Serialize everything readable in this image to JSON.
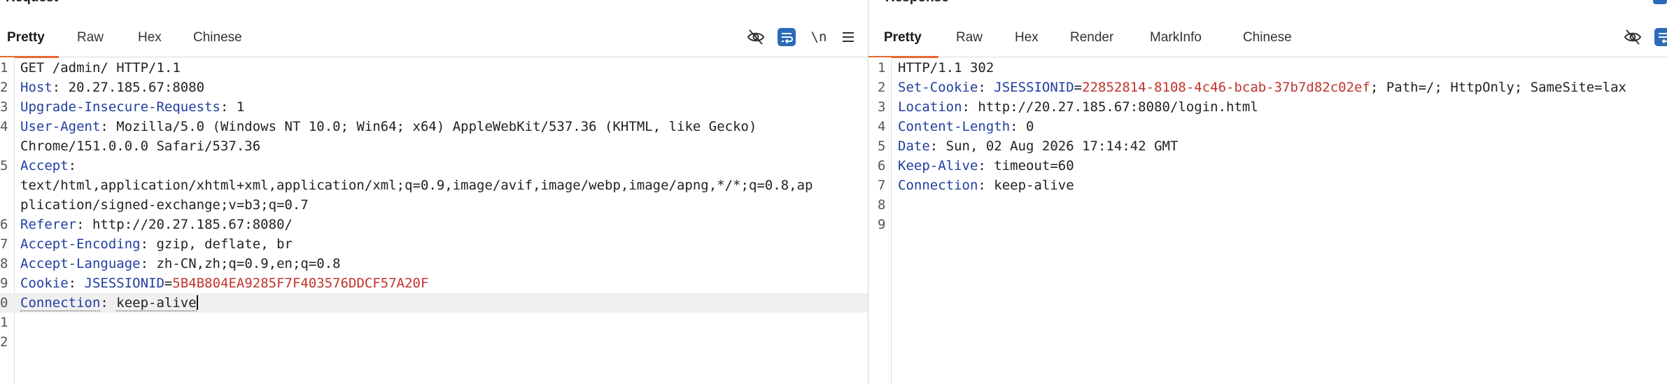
{
  "request": {
    "title": "Request",
    "tabs": [
      "Pretty",
      "Raw",
      "Hex",
      "Chinese"
    ],
    "active_tab": "Pretty",
    "toolbar": {
      "hide_icon": "eye-slash-icon",
      "wrap_icon": "wrap-lines-icon",
      "newline_label": "\\n",
      "menu_icon": "hamburger-menu-icon"
    },
    "lines": [
      {
        "no": "1",
        "text": "GET /admin/ HTTP/1.1"
      },
      {
        "no": "2",
        "name": "Host",
        "sep": ": ",
        "value": "20.27.185.67:8080"
      },
      {
        "no": "3",
        "name": "Upgrade-Insecure-Requests",
        "sep": ": ",
        "value": "1"
      },
      {
        "no": "4",
        "name": "User-Agent",
        "sep": ": ",
        "value": "Mozilla/5.0 (Windows NT 10.0; Win64; x64) AppleWebKit/537.36 (KHTML, like Gecko)"
      },
      {
        "no": "",
        "text": "Chrome/151.0.0.0 Safari/537.36"
      },
      {
        "no": "5",
        "name": "Accept",
        "sep": ":",
        "value": ""
      },
      {
        "no": "",
        "text": "text/html,application/xhtml+xml,application/xml;q=0.9,image/avif,image/webp,image/apng,*/*;q=0.8,ap"
      },
      {
        "no": "",
        "text": "plication/signed-exchange;v=b3;q=0.7"
      },
      {
        "no": "6",
        "name": "Referer",
        "sep": ": ",
        "value": "http://20.27.185.67:8080/"
      },
      {
        "no": "7",
        "name": "Accept-Encoding",
        "sep": ": ",
        "value": "gzip, deflate, br"
      },
      {
        "no": "8",
        "name": "Accept-Language",
        "sep": ": ",
        "value": "zh-CN,zh;q=0.9,en;q=0.8"
      },
      {
        "no": "9",
        "name": "Cookie",
        "sep": ": ",
        "cookie_name": "JSESSIONID",
        "cookie_eq": "=",
        "cookie_value": "5B4B804EA9285F7F403576DDCF57A20F"
      },
      {
        "no": "0",
        "name": "Connection",
        "sep": ": ",
        "value": "keep-alive",
        "current": true
      },
      {
        "no": "1",
        "text": ""
      },
      {
        "no": "2",
        "text": ""
      }
    ]
  },
  "response": {
    "title": "Response",
    "tabs": [
      "Pretty",
      "Raw",
      "Hex",
      "Render",
      "MarkInfo",
      "Chinese"
    ],
    "active_tab": "Pretty",
    "toolbar": {
      "hide_icon": "eye-slash-icon",
      "wrap_icon": "wrap-lines-icon"
    },
    "lines": [
      {
        "no": "1",
        "text": "HTTP/1.1 302"
      },
      {
        "no": "2",
        "name": "Set-Cookie",
        "sep": ": ",
        "cookie_name": "JSESSIONID",
        "cookie_eq": "=",
        "cookie_value": "22852814-8108-4c46-bcab-37b7d82c02ef",
        "rest": "; Path=/; HttpOnly; SameSite=lax"
      },
      {
        "no": "3",
        "name": "Location",
        "sep": ": ",
        "value": "http://20.27.185.67:8080/login.html"
      },
      {
        "no": "4",
        "name": "Content-Length",
        "sep": ": ",
        "value": "0"
      },
      {
        "no": "5",
        "name": "Date",
        "sep": ": ",
        "value": "Sun, 02 Aug 2026 17:14:42 GMT"
      },
      {
        "no": "6",
        "name": "Keep-Alive",
        "sep": ": ",
        "value": "timeout=60"
      },
      {
        "no": "7",
        "name": "Connection",
        "sep": ": ",
        "value": "keep-alive"
      },
      {
        "no": "8",
        "text": ""
      },
      {
        "no": "9",
        "text": ""
      }
    ]
  },
  "colors": {
    "header_name": "#1f3fa0",
    "cookie_value": "#c0342c",
    "active_tab_underline": "#e8692f",
    "toolbar_accent": "#2a6bb8"
  }
}
